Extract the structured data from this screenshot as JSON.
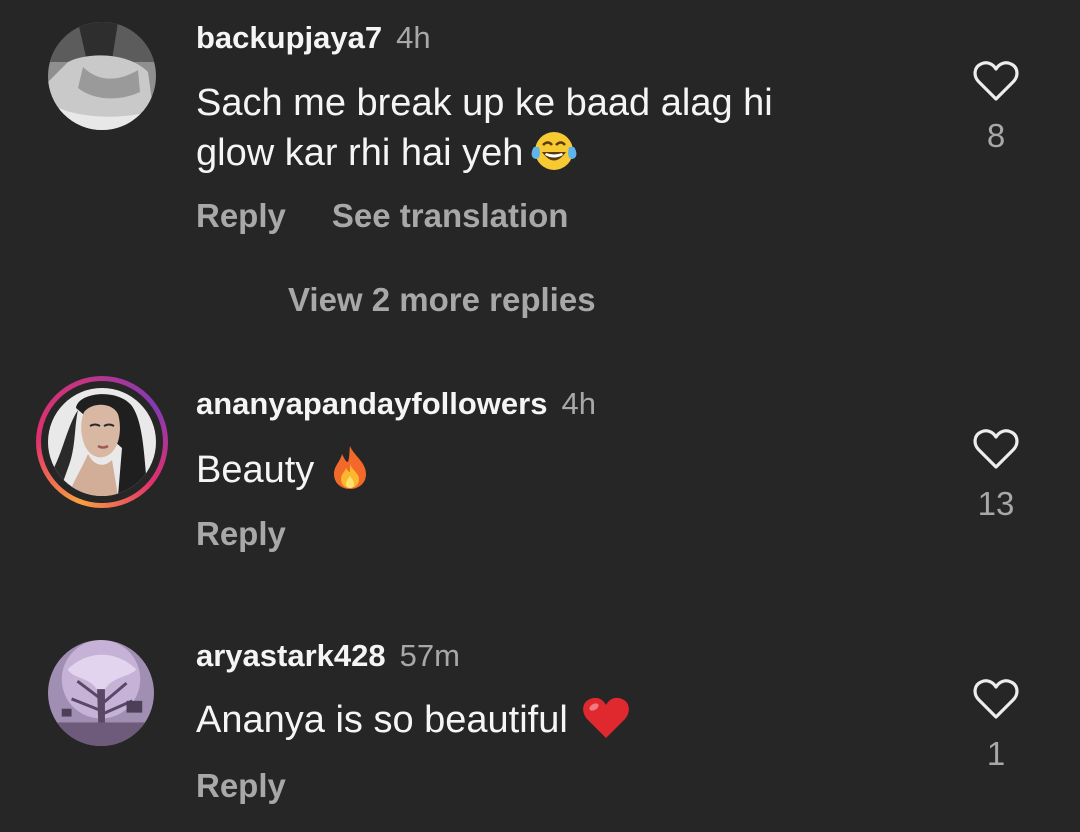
{
  "comments": [
    {
      "username": "backupjaya7",
      "time": "4h",
      "text_line1": "Sach me break up ke baad alag hi",
      "text_line2": "glow kar rhi hai yeh",
      "emoji_icon": "face-with-tears-of-joy-icon",
      "reply_label": "Reply",
      "translation_label": "See translation",
      "likes": "8"
    },
    {
      "username": "ananyapandayfollowers",
      "time": "4h",
      "text": "Beauty",
      "emoji_icon": "fire-icon",
      "reply_label": "Reply",
      "likes": "13",
      "story_ring": true
    },
    {
      "username": "aryastark428",
      "time": "57m",
      "text": "Ananya is so beautiful",
      "emoji_icon": "red-heart-icon",
      "reply_label": "Reply",
      "likes": "1"
    }
  ],
  "view_replies_label": "View 2 more replies",
  "colors": {
    "background": "#262626",
    "primary_text": "#f5f5f5",
    "secondary_text": "#a8a8a8"
  }
}
